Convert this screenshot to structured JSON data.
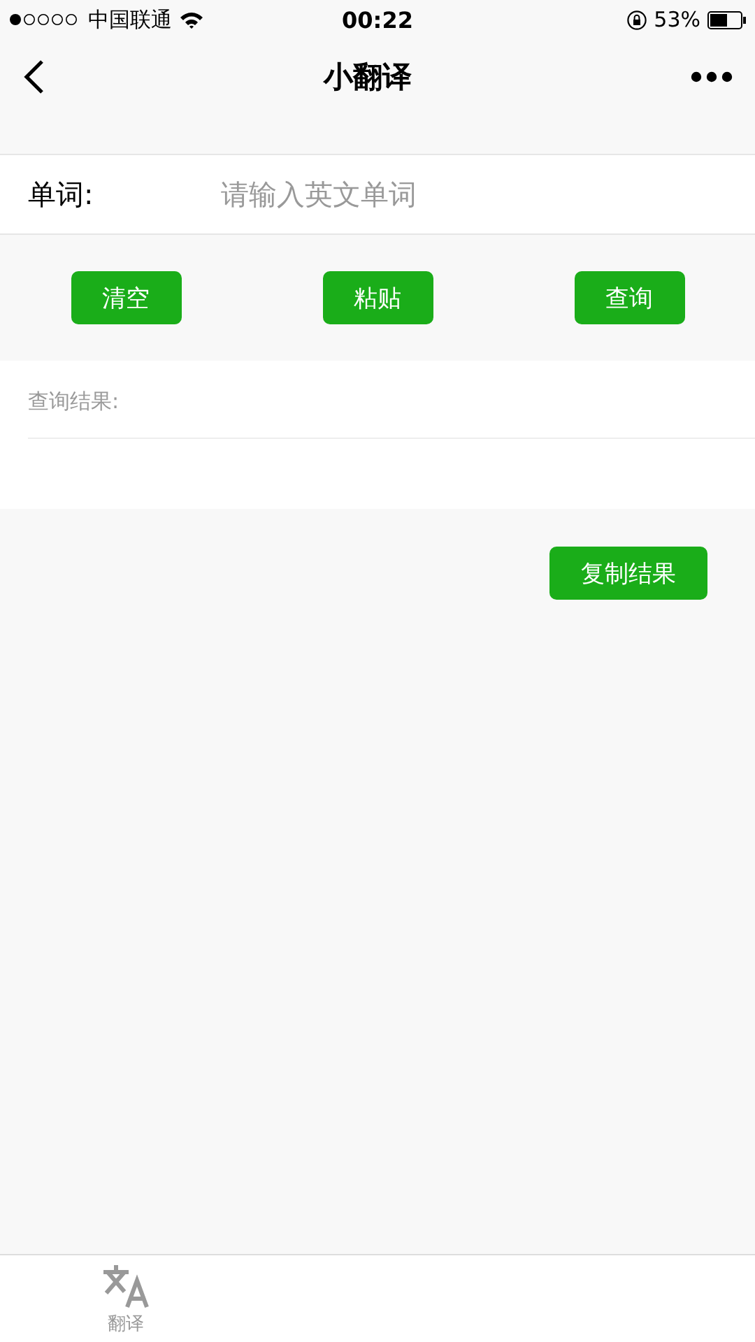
{
  "status_bar": {
    "carrier": "中国联通",
    "time": "00:22",
    "battery": "53%"
  },
  "nav_bar": {
    "title": "小翻译"
  },
  "word_field": {
    "label": "单词:",
    "placeholder": "请输入英文单词"
  },
  "buttons": [
    "清空",
    "粘贴",
    "查询"
  ],
  "result": {
    "label": "查询结果:"
  },
  "copy_button": "复制结果",
  "tabs": [
    {
      "label": "翻译",
      "selected": false
    }
  ]
}
